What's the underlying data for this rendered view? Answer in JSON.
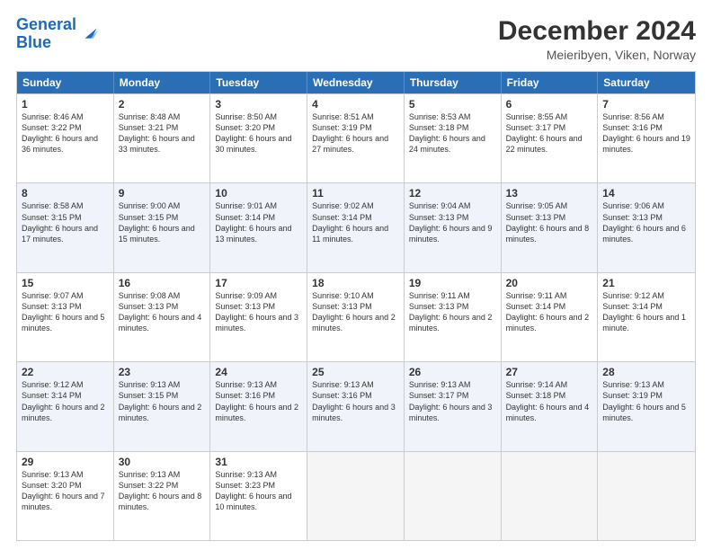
{
  "header": {
    "logo_line1": "General",
    "logo_line2": "Blue",
    "title": "December 2024",
    "subtitle": "Meieribyen, Viken, Norway"
  },
  "calendar": {
    "days": [
      "Sunday",
      "Monday",
      "Tuesday",
      "Wednesday",
      "Thursday",
      "Friday",
      "Saturday"
    ],
    "rows": [
      [
        {
          "num": "1",
          "rise": "8:46 AM",
          "set": "3:22 PM",
          "daylight": "6 hours and 36 minutes."
        },
        {
          "num": "2",
          "rise": "8:48 AM",
          "set": "3:21 PM",
          "daylight": "6 hours and 33 minutes."
        },
        {
          "num": "3",
          "rise": "8:50 AM",
          "set": "3:20 PM",
          "daylight": "6 hours and 30 minutes."
        },
        {
          "num": "4",
          "rise": "8:51 AM",
          "set": "3:19 PM",
          "daylight": "6 hours and 27 minutes."
        },
        {
          "num": "5",
          "rise": "8:53 AM",
          "set": "3:18 PM",
          "daylight": "6 hours and 24 minutes."
        },
        {
          "num": "6",
          "rise": "8:55 AM",
          "set": "3:17 PM",
          "daylight": "6 hours and 22 minutes."
        },
        {
          "num": "7",
          "rise": "8:56 AM",
          "set": "3:16 PM",
          "daylight": "6 hours and 19 minutes."
        }
      ],
      [
        {
          "num": "8",
          "rise": "8:58 AM",
          "set": "3:15 PM",
          "daylight": "6 hours and 17 minutes."
        },
        {
          "num": "9",
          "rise": "9:00 AM",
          "set": "3:15 PM",
          "daylight": "6 hours and 15 minutes."
        },
        {
          "num": "10",
          "rise": "9:01 AM",
          "set": "3:14 PM",
          "daylight": "6 hours and 13 minutes."
        },
        {
          "num": "11",
          "rise": "9:02 AM",
          "set": "3:14 PM",
          "daylight": "6 hours and 11 minutes."
        },
        {
          "num": "12",
          "rise": "9:04 AM",
          "set": "3:13 PM",
          "daylight": "6 hours and 9 minutes."
        },
        {
          "num": "13",
          "rise": "9:05 AM",
          "set": "3:13 PM",
          "daylight": "6 hours and 8 minutes."
        },
        {
          "num": "14",
          "rise": "9:06 AM",
          "set": "3:13 PM",
          "daylight": "6 hours and 6 minutes."
        }
      ],
      [
        {
          "num": "15",
          "rise": "9:07 AM",
          "set": "3:13 PM",
          "daylight": "6 hours and 5 minutes."
        },
        {
          "num": "16",
          "rise": "9:08 AM",
          "set": "3:13 PM",
          "daylight": "6 hours and 4 minutes."
        },
        {
          "num": "17",
          "rise": "9:09 AM",
          "set": "3:13 PM",
          "daylight": "6 hours and 3 minutes."
        },
        {
          "num": "18",
          "rise": "9:10 AM",
          "set": "3:13 PM",
          "daylight": "6 hours and 2 minutes."
        },
        {
          "num": "19",
          "rise": "9:11 AM",
          "set": "3:13 PM",
          "daylight": "6 hours and 2 minutes."
        },
        {
          "num": "20",
          "rise": "9:11 AM",
          "set": "3:14 PM",
          "daylight": "6 hours and 2 minutes."
        },
        {
          "num": "21",
          "rise": "9:12 AM",
          "set": "3:14 PM",
          "daylight": "6 hours and 1 minute."
        }
      ],
      [
        {
          "num": "22",
          "rise": "9:12 AM",
          "set": "3:14 PM",
          "daylight": "6 hours and 2 minutes."
        },
        {
          "num": "23",
          "rise": "9:13 AM",
          "set": "3:15 PM",
          "daylight": "6 hours and 2 minutes."
        },
        {
          "num": "24",
          "rise": "9:13 AM",
          "set": "3:16 PM",
          "daylight": "6 hours and 2 minutes."
        },
        {
          "num": "25",
          "rise": "9:13 AM",
          "set": "3:16 PM",
          "daylight": "6 hours and 3 minutes."
        },
        {
          "num": "26",
          "rise": "9:13 AM",
          "set": "3:17 PM",
          "daylight": "6 hours and 3 minutes."
        },
        {
          "num": "27",
          "rise": "9:14 AM",
          "set": "3:18 PM",
          "daylight": "6 hours and 4 minutes."
        },
        {
          "num": "28",
          "rise": "9:13 AM",
          "set": "3:19 PM",
          "daylight": "6 hours and 5 minutes."
        }
      ],
      [
        {
          "num": "29",
          "rise": "9:13 AM",
          "set": "3:20 PM",
          "daylight": "6 hours and 7 minutes."
        },
        {
          "num": "30",
          "rise": "9:13 AM",
          "set": "3:22 PM",
          "daylight": "6 hours and 8 minutes."
        },
        {
          "num": "31",
          "rise": "9:13 AM",
          "set": "3:23 PM",
          "daylight": "6 hours and 10 minutes."
        },
        null,
        null,
        null,
        null
      ]
    ]
  },
  "labels": {
    "sunrise": "Sunrise:",
    "sunset": "Sunset:",
    "daylight": "Daylight:"
  }
}
